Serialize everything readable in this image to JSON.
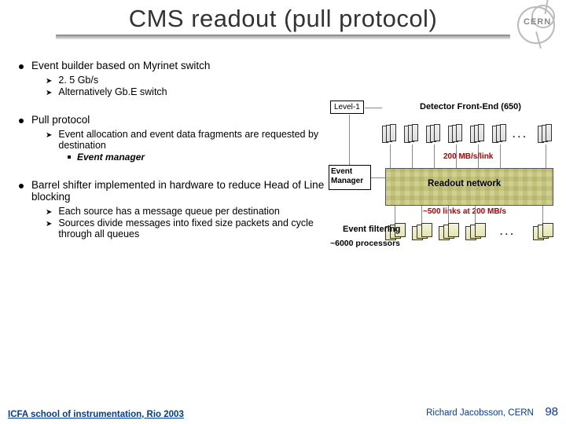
{
  "logo_text": "CERN",
  "title": "CMS readout (pull protocol)",
  "bullets": {
    "b1_1": "Event builder based on Myrinet switch",
    "b1_1_s1": "2. 5 Gb/s",
    "b1_1_s2": "Alternatively Gb.E switch",
    "b1_2": "Pull protocol",
    "b1_2_s1": "Event allocation and event data fragments are requested by destination",
    "b1_2_s1_a": "Event manager",
    "b1_3": "Barrel shifter implemented in hardware to reduce Head of Line blocking",
    "b1_3_s1": "Each source has a message queue per destination",
    "b1_3_s2": "Sources divide messages into fixed size packets and cycle through all queues"
  },
  "diagram": {
    "level1": "Level-1",
    "detector_label": "Detector Front-End (650)",
    "rate_link": "200 MB/s/link",
    "readout_net": "Readout network",
    "links_rate": "~500 links at 200 MB/s",
    "event_manager": "Event Manager",
    "event_filtering": "Event filtering",
    "processors": "~6000 processors",
    "ellipsis": ". . ."
  },
  "footer": {
    "left": "ICFA school of instrumentation, Rio 2003",
    "right": "Richard Jacobsson, CERN",
    "slide": "98"
  }
}
